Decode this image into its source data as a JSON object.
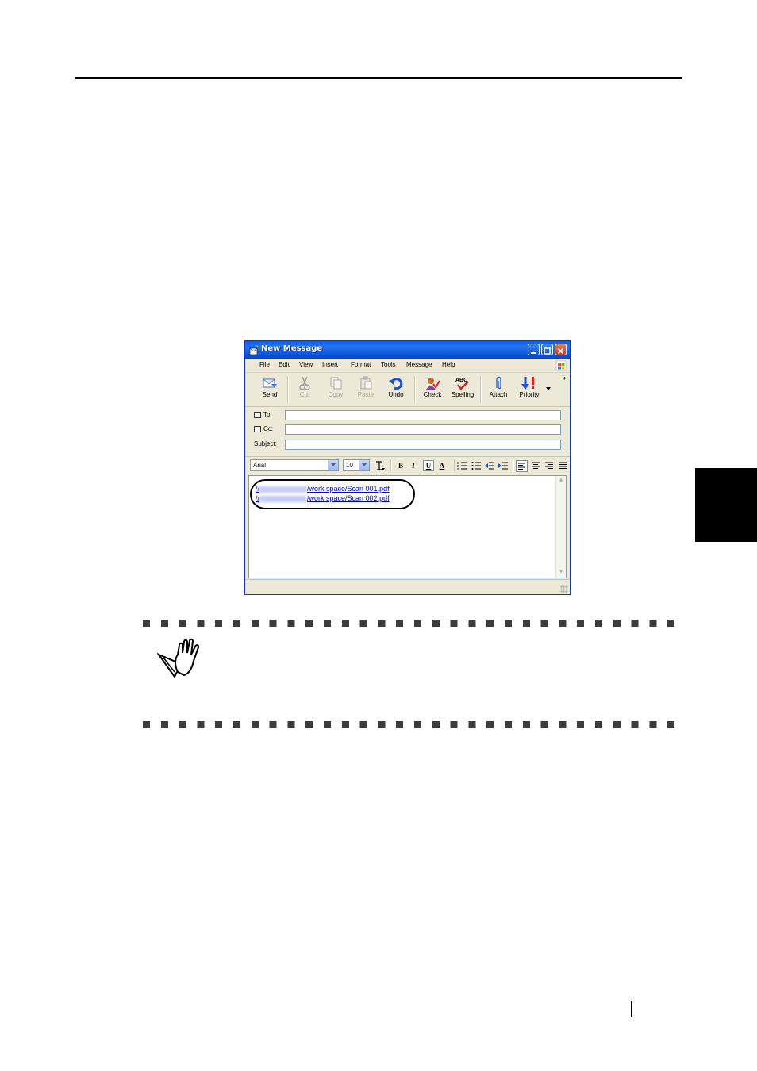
{
  "window": {
    "title": "New Message",
    "menu": [
      "File",
      "Edit",
      "View",
      "Insert",
      "Format",
      "Tools",
      "Message",
      "Help"
    ],
    "toolbar": [
      {
        "label": "Send",
        "icon": "send-icon",
        "enabled": true
      },
      {
        "label": "Cut",
        "icon": "scissors-icon",
        "enabled": false
      },
      {
        "label": "Copy",
        "icon": "copy-icon",
        "enabled": false
      },
      {
        "label": "Paste",
        "icon": "paste-icon",
        "enabled": false
      },
      {
        "label": "Undo",
        "icon": "undo-icon",
        "enabled": true
      },
      {
        "label": "Check",
        "icon": "check-names-icon",
        "enabled": true
      },
      {
        "label": "Spelling",
        "icon": "spelling-icon",
        "enabled": true
      },
      {
        "label": "Attach",
        "icon": "paperclip-icon",
        "enabled": true
      },
      {
        "label": "Priority",
        "icon": "priority-icon",
        "enabled": true
      }
    ],
    "toolbar_overflow": "»",
    "fields": {
      "to_label": "To:",
      "cc_label": "Cc:",
      "subject_label": "Subject:",
      "to_value": "",
      "cc_value": "",
      "subject_value": ""
    },
    "format": {
      "font": "Arial",
      "size": "10",
      "bold": "B",
      "italic": "I",
      "underline": "U",
      "font_color": "A"
    },
    "body": {
      "links": [
        {
          "prefix": "//",
          "path": "/work space/Scan 001.pdf"
        },
        {
          "prefix": "//",
          "path": "/work space/Scan 002.pdf"
        }
      ]
    }
  },
  "colors": {
    "titlebar": "#0a5fe8",
    "chrome": "#ece9d8",
    "link": "#0000cc",
    "side_tab": "#000000"
  }
}
